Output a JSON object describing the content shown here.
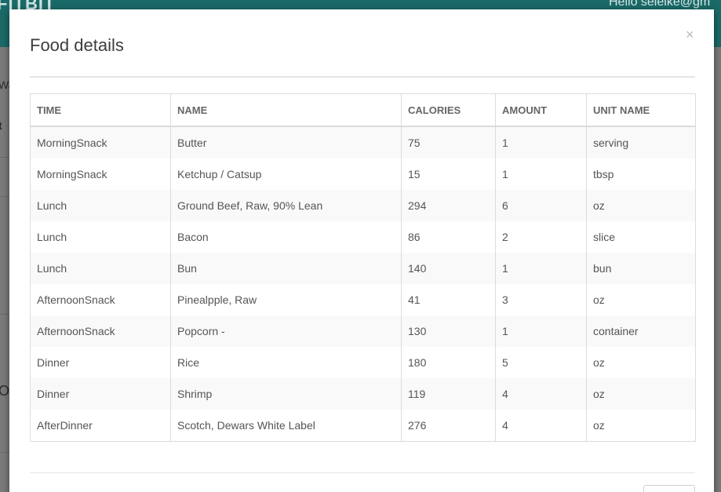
{
  "background": {
    "logo_text": "FITBIT",
    "user_greeting": "Hello seleike@gm",
    "fragments": [
      "Wa",
      "t",
      "O"
    ]
  },
  "modal": {
    "title": "Food details",
    "close_symbol": "×",
    "table": {
      "columns": [
        "TIME",
        "NAME",
        "CALORIES",
        "AMOUNT",
        "UNIT NAME"
      ],
      "rows": [
        [
          "MorningSnack",
          "Butter",
          "75",
          "1",
          "serving"
        ],
        [
          "MorningSnack",
          "Ketchup / Catsup",
          "15",
          "1",
          "tbsp"
        ],
        [
          "Lunch",
          "Ground Beef, Raw, 90% Lean",
          "294",
          "6",
          "oz"
        ],
        [
          "Lunch",
          "Bacon",
          "86",
          "2",
          "slice"
        ],
        [
          "Lunch",
          "Bun",
          "140",
          "1",
          "bun"
        ],
        [
          "AfternoonSnack",
          "Pinealpple, Raw",
          "41",
          "3",
          "oz"
        ],
        [
          "AfternoonSnack",
          "Popcorn -",
          "130",
          "1",
          "container"
        ],
        [
          "Dinner",
          "Rice",
          "180",
          "5",
          "oz"
        ],
        [
          "Dinner",
          "Shrimp",
          "119",
          "4",
          "oz"
        ],
        [
          "AfterDinner",
          "Scotch, Dewars White Label",
          "276",
          "4",
          "oz"
        ]
      ]
    }
  },
  "colors": {
    "header_teal": "#1a6a68",
    "overlay": "#7f7f7f",
    "stripe": "#f9f9f9"
  }
}
